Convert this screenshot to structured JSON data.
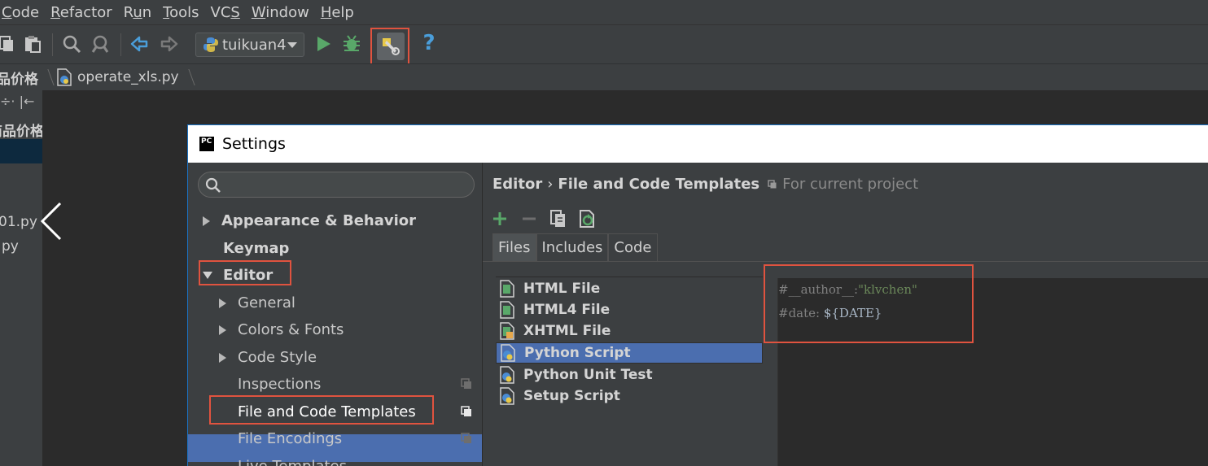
{
  "menubar": {
    "items": [
      {
        "mnemonic": "C",
        "rest": "ode"
      },
      {
        "mnemonic": "R",
        "rest": "efactor"
      },
      {
        "pre": "R",
        "mnemonic": "u",
        "rest": "n"
      },
      {
        "mnemonic": "T",
        "rest": "ools"
      },
      {
        "pre": "VC",
        "mnemonic": "S",
        "rest": ""
      },
      {
        "mnemonic": "W",
        "rest": "indow"
      },
      {
        "mnemonic": "H",
        "rest": "elp"
      }
    ]
  },
  "toolbar": {
    "run_config": "tuikuan4",
    "help_label": "?"
  },
  "breadcrumb": {
    "project_fragment": "品价格",
    "file": "operate_xls.py"
  },
  "project_panel": {
    "tools_glyph": "÷· |←",
    "folder_fragment": "商品价格",
    "file1_fragment": "01.py",
    "file2_fragment": "py"
  },
  "dialog": {
    "title": "Settings",
    "app_icon": "PC"
  },
  "settings_tree": {
    "search_placeholder": "",
    "items": {
      "appearance": "Appearance & Behavior",
      "keymap": "Keymap",
      "editor": "Editor",
      "general": "General",
      "colors_fonts": "Colors & Fonts",
      "code_style": "Code Style",
      "inspections": "Inspections",
      "file_code_templates": "File and Code Templates",
      "file_encodings": "File Encodings",
      "live_templates": "Live Templates"
    }
  },
  "content": {
    "breadcrumb_editor": "Editor",
    "breadcrumb_sep": "›",
    "breadcrumb_page": "File and Code Templates",
    "scope_note": "For current project",
    "tabs": [
      "Files",
      "Includes",
      "Code"
    ],
    "templates": [
      "HTML File",
      "HTML4 File",
      "XHTML File",
      "Python Script",
      "Python Unit Test",
      "Setup Script"
    ],
    "code": {
      "line1_prefix": "#__author__:",
      "line1_string": "\"klvchen\"",
      "line2_prefix": "#date: ",
      "line2_var": "${DATE}"
    }
  },
  "colors": {
    "selection": "#4b6eaf",
    "highlight_box": "#e0533f",
    "run_green": "#59a869",
    "help_blue": "#4a9eda"
  }
}
